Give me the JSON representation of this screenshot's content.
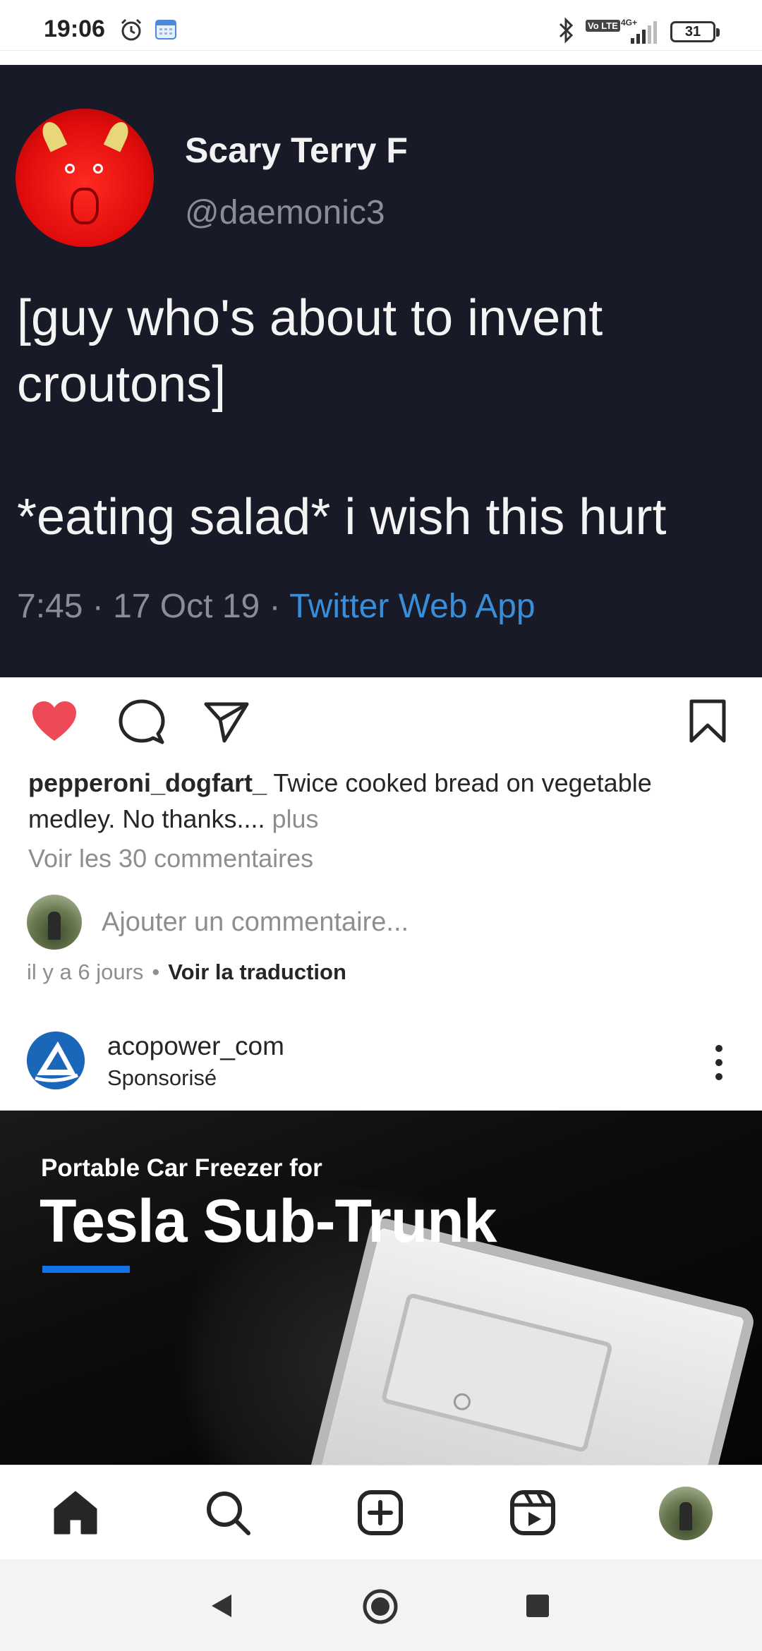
{
  "status_bar": {
    "time": "19:06",
    "volte": "Vo LTE",
    "network": "4G+",
    "battery": "31"
  },
  "post": {
    "tweet": {
      "display_name": "Scary Terry F",
      "handle": "@daemonic3",
      "text": "[guy who's about to invent\ncroutons]\n\n*eating salad* i wish this hurt",
      "meta_time": "7:45 · 17 Oct 19 · ",
      "meta_source": "Twitter Web App"
    },
    "liked": true,
    "like_color": "#ed4956",
    "caption_user": "pepperoni_dogfart_",
    "caption_text": " Twice cooked bread on vegetable medley. No thanks....",
    "caption_more": " plus",
    "view_comments": "Voir les 30 commentaires",
    "add_comment_placeholder": "Ajouter un commentaire...",
    "time_ago": "il y a 6 jours",
    "separator": "•",
    "translate_label": "Voir la traduction"
  },
  "sponsored": {
    "account": "acopower_com",
    "label": "Sponsorisé",
    "brand_color": "#1a66b8",
    "ad": {
      "subtitle": "Portable Car Freezer for",
      "title": "Tesla Sub-Trunk",
      "accent": "#1473e6"
    }
  },
  "icons": {
    "like": "heart-icon",
    "comment": "comment-icon",
    "share": "send-icon",
    "save": "bookmark-icon",
    "more": "more-vertical-icon",
    "home": "home-icon",
    "search": "search-icon",
    "create": "create-icon",
    "reels": "reels-icon"
  }
}
